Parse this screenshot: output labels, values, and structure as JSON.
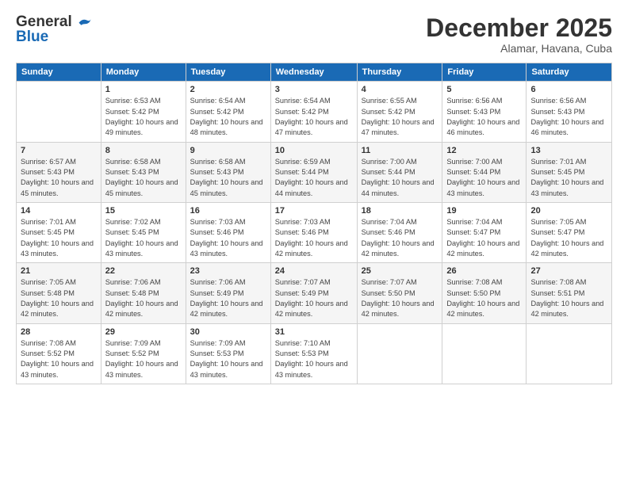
{
  "header": {
    "logo_line1": "General",
    "logo_line2": "Blue",
    "month_title": "December 2025",
    "location": "Alamar, Havana, Cuba"
  },
  "days_of_week": [
    "Sunday",
    "Monday",
    "Tuesday",
    "Wednesday",
    "Thursday",
    "Friday",
    "Saturday"
  ],
  "weeks": [
    [
      {
        "day": "",
        "info": ""
      },
      {
        "day": "1",
        "info": "Sunrise: 6:53 AM\nSunset: 5:42 PM\nDaylight: 10 hours\nand 49 minutes."
      },
      {
        "day": "2",
        "info": "Sunrise: 6:54 AM\nSunset: 5:42 PM\nDaylight: 10 hours\nand 48 minutes."
      },
      {
        "day": "3",
        "info": "Sunrise: 6:54 AM\nSunset: 5:42 PM\nDaylight: 10 hours\nand 47 minutes."
      },
      {
        "day": "4",
        "info": "Sunrise: 6:55 AM\nSunset: 5:42 PM\nDaylight: 10 hours\nand 47 minutes."
      },
      {
        "day": "5",
        "info": "Sunrise: 6:56 AM\nSunset: 5:43 PM\nDaylight: 10 hours\nand 46 minutes."
      },
      {
        "day": "6",
        "info": "Sunrise: 6:56 AM\nSunset: 5:43 PM\nDaylight: 10 hours\nand 46 minutes."
      }
    ],
    [
      {
        "day": "7",
        "info": "Sunrise: 6:57 AM\nSunset: 5:43 PM\nDaylight: 10 hours\nand 45 minutes."
      },
      {
        "day": "8",
        "info": "Sunrise: 6:58 AM\nSunset: 5:43 PM\nDaylight: 10 hours\nand 45 minutes."
      },
      {
        "day": "9",
        "info": "Sunrise: 6:58 AM\nSunset: 5:43 PM\nDaylight: 10 hours\nand 45 minutes."
      },
      {
        "day": "10",
        "info": "Sunrise: 6:59 AM\nSunset: 5:44 PM\nDaylight: 10 hours\nand 44 minutes."
      },
      {
        "day": "11",
        "info": "Sunrise: 7:00 AM\nSunset: 5:44 PM\nDaylight: 10 hours\nand 44 minutes."
      },
      {
        "day": "12",
        "info": "Sunrise: 7:00 AM\nSunset: 5:44 PM\nDaylight: 10 hours\nand 43 minutes."
      },
      {
        "day": "13",
        "info": "Sunrise: 7:01 AM\nSunset: 5:45 PM\nDaylight: 10 hours\nand 43 minutes."
      }
    ],
    [
      {
        "day": "14",
        "info": "Sunrise: 7:01 AM\nSunset: 5:45 PM\nDaylight: 10 hours\nand 43 minutes."
      },
      {
        "day": "15",
        "info": "Sunrise: 7:02 AM\nSunset: 5:45 PM\nDaylight: 10 hours\nand 43 minutes."
      },
      {
        "day": "16",
        "info": "Sunrise: 7:03 AM\nSunset: 5:46 PM\nDaylight: 10 hours\nand 43 minutes."
      },
      {
        "day": "17",
        "info": "Sunrise: 7:03 AM\nSunset: 5:46 PM\nDaylight: 10 hours\nand 42 minutes."
      },
      {
        "day": "18",
        "info": "Sunrise: 7:04 AM\nSunset: 5:46 PM\nDaylight: 10 hours\nand 42 minutes."
      },
      {
        "day": "19",
        "info": "Sunrise: 7:04 AM\nSunset: 5:47 PM\nDaylight: 10 hours\nand 42 minutes."
      },
      {
        "day": "20",
        "info": "Sunrise: 7:05 AM\nSunset: 5:47 PM\nDaylight: 10 hours\nand 42 minutes."
      }
    ],
    [
      {
        "day": "21",
        "info": "Sunrise: 7:05 AM\nSunset: 5:48 PM\nDaylight: 10 hours\nand 42 minutes."
      },
      {
        "day": "22",
        "info": "Sunrise: 7:06 AM\nSunset: 5:48 PM\nDaylight: 10 hours\nand 42 minutes."
      },
      {
        "day": "23",
        "info": "Sunrise: 7:06 AM\nSunset: 5:49 PM\nDaylight: 10 hours\nand 42 minutes."
      },
      {
        "day": "24",
        "info": "Sunrise: 7:07 AM\nSunset: 5:49 PM\nDaylight: 10 hours\nand 42 minutes."
      },
      {
        "day": "25",
        "info": "Sunrise: 7:07 AM\nSunset: 5:50 PM\nDaylight: 10 hours\nand 42 minutes."
      },
      {
        "day": "26",
        "info": "Sunrise: 7:08 AM\nSunset: 5:50 PM\nDaylight: 10 hours\nand 42 minutes."
      },
      {
        "day": "27",
        "info": "Sunrise: 7:08 AM\nSunset: 5:51 PM\nDaylight: 10 hours\nand 42 minutes."
      }
    ],
    [
      {
        "day": "28",
        "info": "Sunrise: 7:08 AM\nSunset: 5:52 PM\nDaylight: 10 hours\nand 43 minutes."
      },
      {
        "day": "29",
        "info": "Sunrise: 7:09 AM\nSunset: 5:52 PM\nDaylight: 10 hours\nand 43 minutes."
      },
      {
        "day": "30",
        "info": "Sunrise: 7:09 AM\nSunset: 5:53 PM\nDaylight: 10 hours\nand 43 minutes."
      },
      {
        "day": "31",
        "info": "Sunrise: 7:10 AM\nSunset: 5:53 PM\nDaylight: 10 hours\nand 43 minutes."
      },
      {
        "day": "",
        "info": ""
      },
      {
        "day": "",
        "info": ""
      },
      {
        "day": "",
        "info": ""
      }
    ]
  ]
}
